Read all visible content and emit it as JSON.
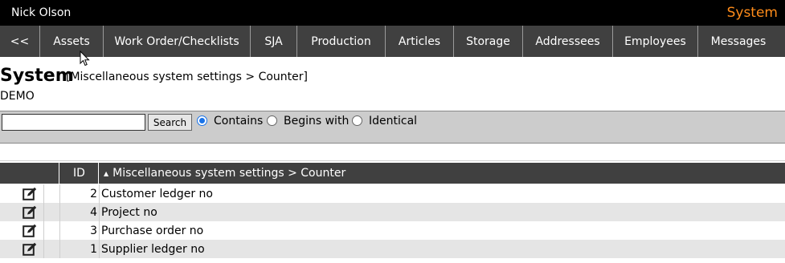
{
  "header": {
    "user_name": "Nick Olson",
    "module_name": "System"
  },
  "nav": {
    "items": [
      {
        "label": "<<"
      },
      {
        "label": "Assets"
      },
      {
        "label": "Work Order/Checklists"
      },
      {
        "label": "SJA"
      },
      {
        "label": "Production"
      },
      {
        "label": "Articles"
      },
      {
        "label": "Storage"
      },
      {
        "label": "Addressees"
      },
      {
        "label": "Employees"
      },
      {
        "label": "Messages"
      }
    ]
  },
  "page": {
    "title": "System",
    "breadcrumb": "[Miscellaneous system settings > Counter]",
    "company": "DEMO"
  },
  "search": {
    "value": "",
    "button_label": "Search",
    "options": [
      "Contains",
      "Begins with",
      "Identical"
    ],
    "selected": "Contains"
  },
  "table": {
    "headers": {
      "id": "ID",
      "description": "Miscellaneous system settings > Counter"
    },
    "rows": [
      {
        "id": "2",
        "description": "Customer ledger no"
      },
      {
        "id": "4",
        "description": "Project no"
      },
      {
        "id": "3",
        "description": "Purchase order no"
      },
      {
        "id": "1",
        "description": "Supplier ledger no"
      }
    ]
  },
  "colors": {
    "accent": "#ff8c1a",
    "nav_bg": "#404040",
    "topbar_bg": "#000000",
    "search_bg": "#cccccc",
    "row_alt": "#e5e5e5"
  }
}
